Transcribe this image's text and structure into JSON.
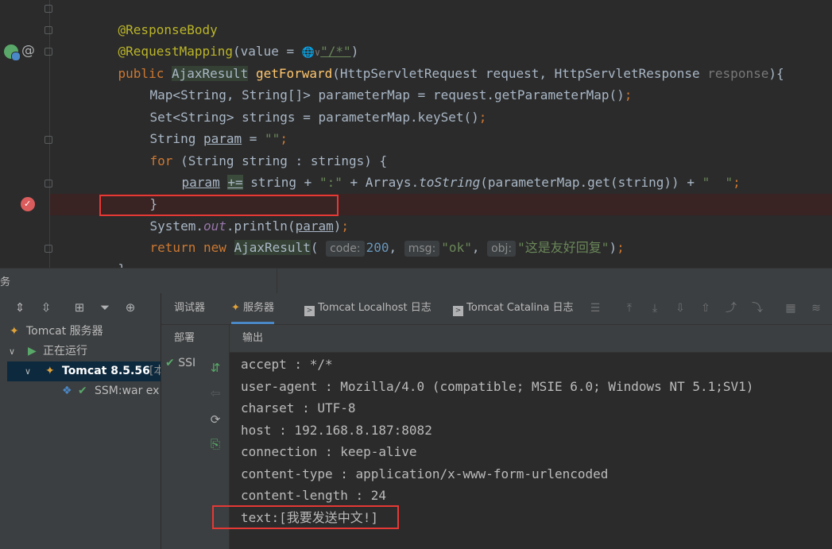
{
  "editor": {
    "lines": {
      "l1": "@ResponseBody",
      "l2_annotation": "@RequestMapping",
      "l2_open": "(value = ",
      "l2_globe": "🌐",
      "l2_chevron": "∨",
      "l2_path": "\"/*\"",
      "l2_close": ")",
      "l3_public": "public ",
      "l3_type": "AjaxResult",
      "l3_space": " ",
      "l3_method": "getForward",
      "l3_params": "(HttpServletRequest request, HttpServletResponse ",
      "l3_unused": "response",
      "l3_end": "){",
      "l4": "Map<String, String[]> parameterMap = request.getParameterMap()",
      "l4_semi": ";",
      "l5": "Set<String> strings = parameterMap.keySet()",
      "l5_semi": ";",
      "l6_pre": "String ",
      "l6_var": "param",
      "l6_eq": " = ",
      "l6_str": "\"\"",
      "l6_semi": ";",
      "l7_for": "for ",
      "l7_rest": "(String string : strings) {",
      "l8_var": "param",
      "l8_sp": " ",
      "l8_op": "+=",
      "l8_a": " string + ",
      "l8_s1": "\":\"",
      "l8_b": " + Arrays.",
      "l8_method": "toString",
      "l8_c": "(parameterMap.get(string)) + ",
      "l8_s2": "\"  \"",
      "l8_semi": ";",
      "l9": "}",
      "l10_a": "System.",
      "l10_field": "out",
      "l10_b": ".println(",
      "l10_var": "param",
      "l10_c": ")",
      "l10_semi": ";",
      "l11_return": "return new ",
      "l11_type": "AjaxResult",
      "l11_paren": "( ",
      "l11_hint_code": "code:",
      "l11_num": "200",
      "l11_comma1": ", ",
      "l11_hint_msg": "msg:",
      "l11_str_ok": "\"ok\"",
      "l11_comma2": ", ",
      "l11_hint_obj": "obj:",
      "l11_str_reply": "\"这是友好回复\"",
      "l11_end": ")",
      "l11_semi": ";",
      "l12": "}"
    },
    "gutter": {
      "at_sign": "@"
    }
  },
  "panel": {
    "title_fragment": "务",
    "toolbar_icons": [
      "expand-all-icon",
      "collapse-all-icon",
      "group-icon",
      "filter-icon",
      "add-icon"
    ],
    "tree": {
      "root": "Tomcat 服务器",
      "running": "正在运行",
      "server": "Tomcat 8.5.56",
      "server_suffix": " [本",
      "artifact": "SSM:war ex"
    },
    "tabs": [
      "调试器",
      "服务器",
      "Tomcat Localhost 日志",
      "Tomcat Catalina 日志"
    ],
    "active_tab": 1,
    "deploy_header": "部署",
    "deploy_item": "SSI",
    "output_header": "输出",
    "output_lines": [
      "accept : */*",
      "user-agent : Mozilla/4.0 (compatible; MSIE 6.0; Windows NT 5.1;SV1)",
      "charset : UTF-8",
      "host : 192.168.8.187:8082",
      "connection : keep-alive",
      "content-type : application/x-www-form-urlencoded",
      "content-length : 24",
      "text:[我要发送中文!]"
    ]
  },
  "colors": {
    "keyword": "#cc7832",
    "annotation": "#bbb529",
    "method": "#ffc66d",
    "string": "#6a8759",
    "number": "#6897bb",
    "highlight_box": "#e53935"
  }
}
